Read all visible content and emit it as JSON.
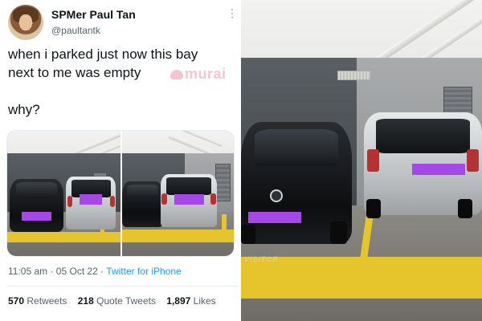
{
  "tweet": {
    "display_name": "SPMer Paul Tan",
    "handle": "@paultantk",
    "more_icon": "more-vertical-icon",
    "text": "when i parked just now this bay\nnext to me was empty\n\nwhy?",
    "watermark": "murai",
    "timestamp": "11:05 am · 05 Oct 22 · ",
    "source": "Twitter for iPhone",
    "stats": {
      "retweets_count": "570",
      "retweets_label": "Retweets",
      "quotes_count": "218",
      "quotes_label": "Quote Tweets",
      "likes_count": "1,897",
      "likes_label": "Likes"
    }
  },
  "photo_caption": {
    "floor_marking": "VISITOR"
  },
  "colors": {
    "link": "#1d9bf0",
    "plate_censor": "#a648e8",
    "bay_marking": "#e5c52b"
  }
}
